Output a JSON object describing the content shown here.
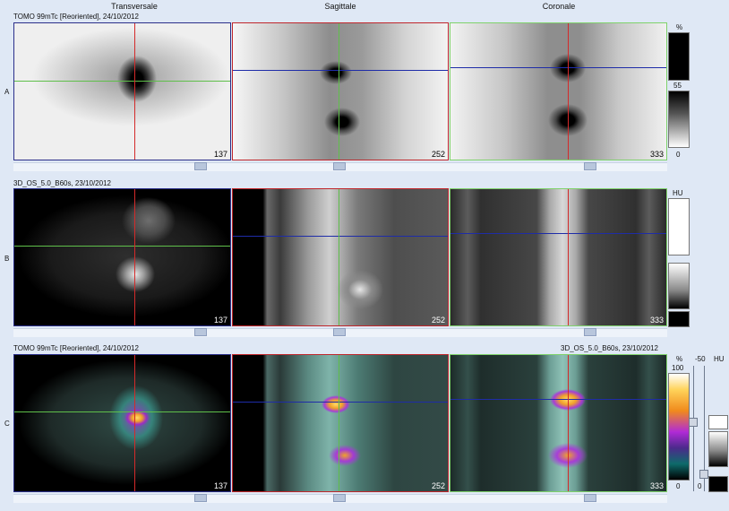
{
  "headers": {
    "transversal": "Transversale",
    "sagittal": "Sagittale",
    "coronal": "Coronale"
  },
  "rows": [
    {
      "label": "A",
      "series": "TOMO 99mTc [Reoriented], 24/10/2012"
    },
    {
      "label": "B",
      "series": "3D_OS_5.0_B60s, 23/10/2012"
    },
    {
      "label": "C",
      "series": "TOMO 99mTc [Reoriented], 24/10/2012",
      "series2": "3D_OS_5.0_B60s, 23/10/2012"
    }
  ],
  "slices": {
    "transversal": "137",
    "sagittal": "252",
    "coronal": "333"
  },
  "scales": {
    "a": {
      "unit": "%",
      "top": "55",
      "bottom": "0"
    },
    "b": {
      "unit": "HU"
    },
    "c": {
      "unit_pct": "%",
      "top": "100",
      "bottom": "0",
      "unit_hu": "HU",
      "val_hu": "-50",
      "val_hu_bottom": "0"
    }
  },
  "colors": {
    "transversal_frame": "#2b2f8a",
    "sagittal_frame": "#c0262b",
    "coronal_frame": "#7fd26b",
    "crosshair_h_green": "#5fbf4a",
    "crosshair_v_red": "#d42a2a",
    "crosshair_h_blue": "#1e2ca8"
  }
}
